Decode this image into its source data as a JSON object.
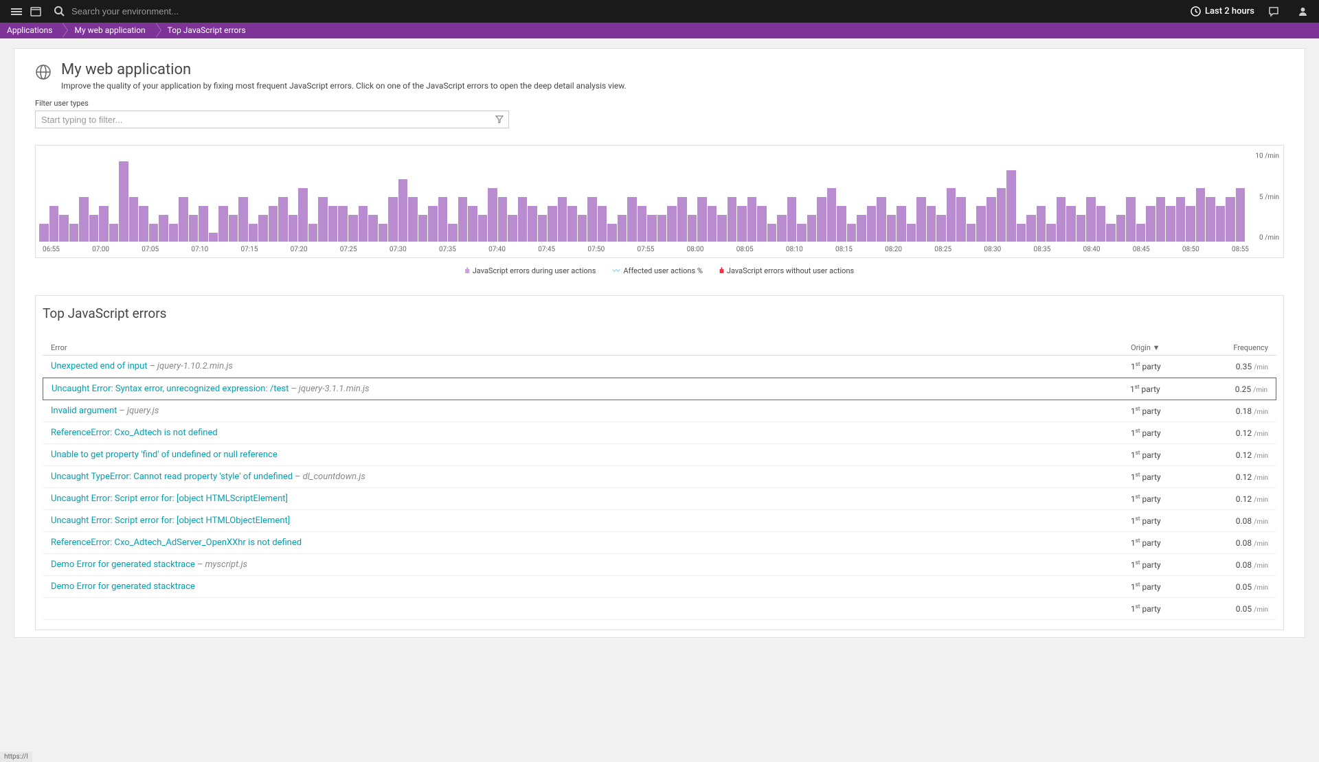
{
  "topbar": {
    "search_placeholder": "Search your environment...",
    "time_range": "Last 2 hours"
  },
  "breadcrumbs": [
    "Applications",
    "My web application",
    "Top JavaScript errors"
  ],
  "page": {
    "title": "My web application",
    "subtitle": "Improve the quality of your application by fixing most frequent JavaScript errors. Click on one of the JavaScript errors to open the deep detail analysis view."
  },
  "filter": {
    "label": "Filter user types",
    "placeholder": "Start typing to filter..."
  },
  "chart_legend": {
    "series1": "JavaScript errors during user actions",
    "series2": "Affected user actions %",
    "series3": "JavaScript errors without user actions"
  },
  "chart_data": {
    "type": "bar",
    "ylabel": "/min",
    "ylim": [
      0,
      10
    ],
    "y_ticks": [
      "10 /min",
      "5 /min",
      "0 /min"
    ],
    "categories": [
      "06:55",
      "07:00",
      "07:05",
      "07:10",
      "07:15",
      "07:20",
      "07:25",
      "07:30",
      "07:35",
      "07:40",
      "07:45",
      "07:50",
      "07:55",
      "08:00",
      "08:05",
      "08:10",
      "08:15",
      "08:20",
      "08:25",
      "08:30",
      "08:35",
      "08:40",
      "08:45",
      "08:50",
      "08:55"
    ],
    "series": [
      {
        "name": "JavaScript errors during user actions",
        "values_per_minute": [
          2,
          4,
          3,
          2,
          5,
          3,
          4,
          2,
          9,
          5,
          4,
          2,
          3,
          2,
          5,
          3,
          4,
          1,
          4,
          3,
          5,
          2,
          3,
          4,
          5,
          3,
          6,
          2,
          5,
          4,
          4,
          3,
          4,
          3,
          2,
          5,
          7,
          5,
          3,
          4,
          5,
          2,
          5,
          4,
          3,
          6,
          5,
          3,
          5,
          4,
          3,
          4,
          5,
          4,
          3,
          5,
          4,
          2,
          3,
          5,
          4,
          3,
          3,
          4,
          5,
          3,
          5,
          4,
          3,
          5,
          4,
          5,
          4,
          2,
          3,
          5,
          2,
          3,
          5,
          6,
          4,
          2,
          3,
          4,
          5,
          3,
          4,
          2,
          5,
          4,
          3,
          6,
          5,
          2,
          4,
          5,
          6,
          8,
          2,
          3,
          4,
          2,
          5,
          4,
          3,
          5,
          4,
          2,
          3,
          5,
          2,
          4,
          5,
          4,
          5,
          4,
          6,
          5,
          4,
          5,
          6
        ],
        "color": "#b98cd0"
      }
    ]
  },
  "errors": {
    "section_title": "Top JavaScript errors",
    "columns": {
      "error": "Error",
      "origin": "Origin ▼",
      "frequency": "Frequency"
    },
    "rows": [
      {
        "msg": "Unexpected end of input",
        "src": "jquery-1.10.2.min.js",
        "origin_ord": "1",
        "origin_sup": "st",
        "origin_kind": "party",
        "freq": "0.35",
        "unit": "/min"
      },
      {
        "msg": "Uncaught Error: Syntax error, unrecognized expression: /test",
        "src": "jquery-3.1.1.min.js",
        "origin_ord": "1",
        "origin_sup": "st",
        "origin_kind": "party",
        "freq": "0.25",
        "unit": "/min",
        "highlight": true
      },
      {
        "msg": "Invalid argument",
        "src": "jquery.js",
        "origin_ord": "1",
        "origin_sup": "st",
        "origin_kind": "party",
        "freq": "0.18",
        "unit": "/min"
      },
      {
        "msg": "ReferenceError: Cxo_Adtech is not defined",
        "src": "",
        "origin_ord": "1",
        "origin_sup": "st",
        "origin_kind": "party",
        "freq": "0.12",
        "unit": "/min"
      },
      {
        "msg": "Unable to get property 'find' of undefined or null reference",
        "src": "",
        "origin_ord": "1",
        "origin_sup": "st",
        "origin_kind": "party",
        "freq": "0.12",
        "unit": "/min"
      },
      {
        "msg": "Uncaught TypeError: Cannot read property 'style' of undefined",
        "src": "dl_countdown.js",
        "origin_ord": "1",
        "origin_sup": "st",
        "origin_kind": "party",
        "freq": "0.12",
        "unit": "/min"
      },
      {
        "msg": "Uncaught Error: Script error for: [object HTMLScriptElement]",
        "src": "",
        "origin_ord": "1",
        "origin_sup": "st",
        "origin_kind": "party",
        "freq": "0.12",
        "unit": "/min"
      },
      {
        "msg": "Uncaught Error: Script error for: [object HTMLObjectElement]",
        "src": "",
        "origin_ord": "1",
        "origin_sup": "st",
        "origin_kind": "party",
        "freq": "0.08",
        "unit": "/min"
      },
      {
        "msg": "ReferenceError: Cxo_Adtech_AdServer_OpenXXhr is not defined",
        "src": "",
        "origin_ord": "1",
        "origin_sup": "st",
        "origin_kind": "party",
        "freq": "0.08",
        "unit": "/min"
      },
      {
        "msg": "Demo Error for generated stacktrace",
        "src": "myscript.js",
        "origin_ord": "1",
        "origin_sup": "st",
        "origin_kind": "party",
        "freq": "0.08",
        "unit": "/min"
      },
      {
        "msg": "Demo Error for generated stacktrace",
        "src": "",
        "origin_ord": "1",
        "origin_sup": "st",
        "origin_kind": "party",
        "freq": "0.05",
        "unit": "/min"
      },
      {
        "msg": "",
        "src": "",
        "origin_ord": "1",
        "origin_sup": "st",
        "origin_kind": "party",
        "freq": "0.05",
        "unit": "/min"
      }
    ]
  },
  "status_url": "https://l"
}
